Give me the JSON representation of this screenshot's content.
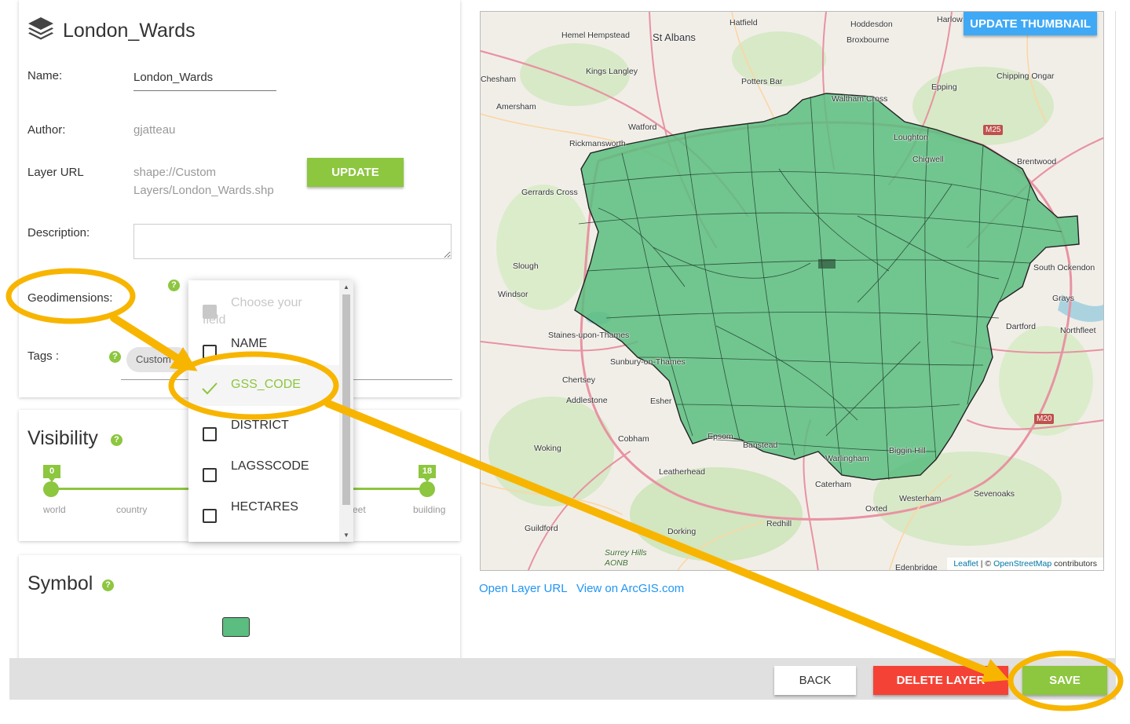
{
  "layer": {
    "title": "London_Wards",
    "name_label": "Name:",
    "name_value": "London_Wards",
    "author_label": "Author:",
    "author_value": "gjatteau",
    "url_label": "Layer URL",
    "url_line1": "shape://Custom",
    "url_line2": "Layers/London_Wards.shp",
    "update_label": "UPDATE",
    "description_label": "Description:",
    "description_value": "",
    "geodimensions_label": "Geodimensions:",
    "tags_label": "Tags :",
    "tag_chip": "Custom"
  },
  "dropdown": {
    "placeholder_line1": "Choose your",
    "placeholder_line2": "field",
    "options": [
      {
        "label": "NAME",
        "checked": false
      },
      {
        "label": "GSS_CODE",
        "checked": true
      },
      {
        "label": "DISTRICT",
        "checked": false
      },
      {
        "label": "LAGSSCODE",
        "checked": false
      },
      {
        "label": "HECTARES",
        "checked": false
      }
    ]
  },
  "visibility": {
    "title": "Visibility",
    "min_value": "0",
    "max_value": "18",
    "ticks": [
      "world",
      "country",
      "eet",
      "building"
    ]
  },
  "symbol": {
    "title": "Symbol",
    "fill_color": "#5bbd7f"
  },
  "map": {
    "update_thumbnail_label": "UPDATE THUMBNAIL",
    "attribution_leaflet": "Leaflet",
    "attribution_sep": " | © ",
    "attribution_osm": "OpenStreetMap",
    "attribution_suffix": " contributors",
    "places": [
      "Hemel Hempstead",
      "St Albans",
      "Hatfield",
      "Hoddesdon",
      "Harlow",
      "Broxbourne",
      "Chesham",
      "Kings Langley",
      "Potters Bar",
      "Epping",
      "Chipping Ongar",
      "Waltham Cross",
      "Amersham",
      "Watford",
      "Rickmansworth",
      "Loughton",
      "Chigwell",
      "Brentwood",
      "Gerrards Cross",
      "Slough",
      "Windsor",
      "Staines-upon-Thames",
      "Sunbury-on-Thames",
      "Chertsey",
      "Addlestone",
      "Esher",
      "Woking",
      "Cobham",
      "Epsom",
      "Banstead",
      "Leatherhead",
      "Warlingham",
      "Caterham",
      "Westerham",
      "Sevenoaks",
      "Oxted",
      "Redhill",
      "Dorking",
      "Guildford",
      "Surrey Hills AONB",
      "Dartford",
      "Grays",
      "Northfleet",
      "South Ockendon",
      "Edenbridge",
      "Biggin Hill"
    ],
    "road_labels": [
      "M25",
      "M20"
    ]
  },
  "links": {
    "open_layer_url": "Open Layer URL",
    "view_on_arcgis": "View on ArcGIS.com"
  },
  "actions": {
    "back": "BACK",
    "delete": "DELETE LAYER",
    "save": "SAVE"
  },
  "colors": {
    "accent_green": "#8dc63f",
    "annotation_yellow": "#f7b500",
    "delete_red": "#f44336",
    "thumbnail_blue": "#3fa9f5"
  }
}
